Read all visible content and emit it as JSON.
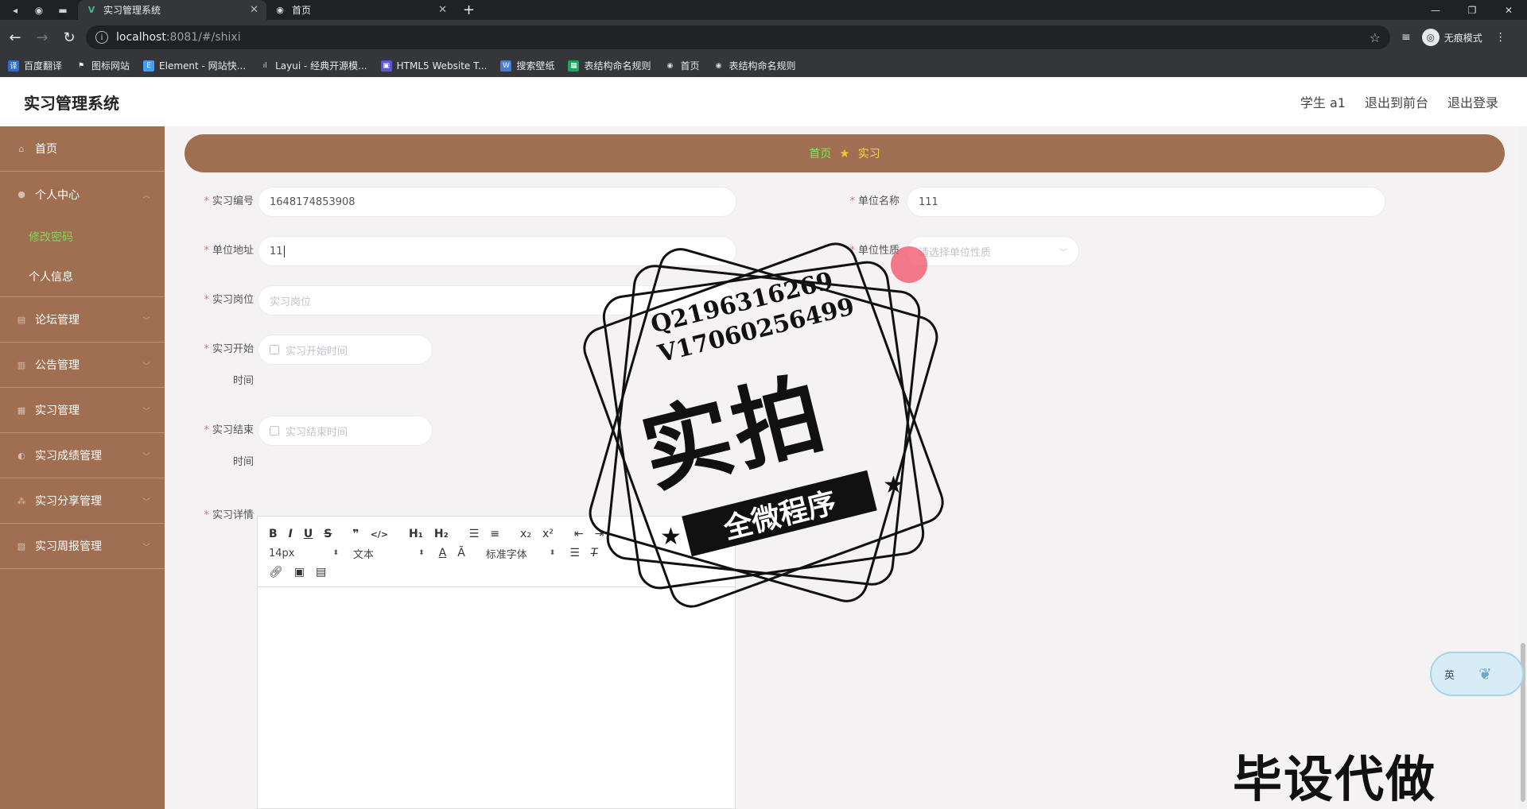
{
  "browser": {
    "tabs": [
      {
        "title": "实习管理系统",
        "active": true,
        "favicon": "vue-icon"
      },
      {
        "title": "首页",
        "active": false,
        "favicon": "globe-icon"
      }
    ],
    "url_host": "localhost",
    "url_rest": ":8081/#/shixi",
    "profile_label": "无痕模式",
    "bookmarks": [
      {
        "label": "百度翻译",
        "icon": "baidu-translate-icon",
        "color": "#2b6cd8"
      },
      {
        "label": "图标网站",
        "icon": "flag-icon",
        "color": "#000000"
      },
      {
        "label": "Element - 网站快...",
        "icon": "element-icon",
        "color": "#409eff"
      },
      {
        "label": "Layui - 经典开源模...",
        "icon": "layui-icon",
        "color": "#555555"
      },
      {
        "label": "HTML5 Website T...",
        "icon": "html5-icon",
        "color": "#5b57d6"
      },
      {
        "label": "搜索壁纸",
        "icon": "wallpaper-icon",
        "color": "#4a7bd0"
      },
      {
        "label": "表结构命名规则",
        "icon": "sheet-icon",
        "color": "#1fa463"
      },
      {
        "label": "首页",
        "icon": "globe-icon",
        "color": "#666666"
      },
      {
        "label": "表结构命名规则",
        "icon": "globe-icon",
        "color": "#666666"
      }
    ]
  },
  "header": {
    "title": "实习管理系统",
    "user": "学生 a1",
    "back_to_front": "退出到前台",
    "logout": "退出登录"
  },
  "sidebar": {
    "home": "首页",
    "personal_center": "个人中心",
    "change_password": "修改密码",
    "personal_info": "个人信息",
    "items": [
      "论坛管理",
      "公告管理",
      "实习管理",
      "实习成绩管理",
      "实习分享管理",
      "实习周报管理"
    ]
  },
  "breadcrumb": {
    "home": "首页",
    "current": "实习"
  },
  "form": {
    "internship_no_label": "实习编号",
    "internship_no_value": "1648174853908",
    "company_name_label": "单位名称",
    "company_name_value": "111",
    "company_address_label": "单位地址",
    "company_address_value": "11",
    "company_nature_label": "单位性质",
    "company_nature_placeholder": "请选择单位性质",
    "position_label": "实习岗位",
    "position_placeholder": "实习岗位",
    "start_time_label_1": "实习开始",
    "start_time_label_2": "时间",
    "start_time_placeholder": "实习开始时间",
    "end_time_label_1": "实习结束",
    "end_time_label_2": "时间",
    "end_time_placeholder": "实习结束时间",
    "details_label": "实习详情"
  },
  "editor": {
    "font_size": "14px",
    "block_format": "文本",
    "font_family": "标准字体"
  },
  "watermark": {
    "contact_q": "Q2196316269",
    "contact_v": "V17060256499",
    "big_text": "实拍",
    "ribbon_text": "全微程序",
    "bottom_text": "毕设代做"
  },
  "widget": {
    "label": "英"
  },
  "colors": {
    "sidebar": "#a06e50",
    "accent_green": "#8ad15d",
    "crumb_current": "#ffd54a"
  }
}
